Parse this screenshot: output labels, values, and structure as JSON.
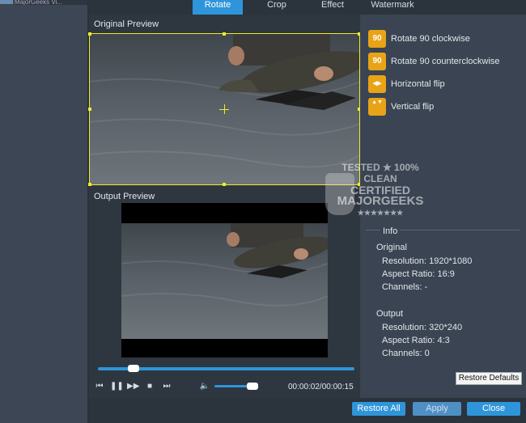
{
  "window": {
    "title": "MajorGeeks Vi..."
  },
  "tabs": [
    "Rotate",
    "Crop",
    "Effect",
    "Watermark"
  ],
  "active_tab": "Rotate",
  "preview": {
    "original_label": "Original Preview",
    "output_label": "Output Preview"
  },
  "rotate_actions": [
    {
      "label": "Rotate 90 clockwise",
      "icon": "rotate-clockwise-icon",
      "glyph": "90"
    },
    {
      "label": "Rotate 90 counterclockwise",
      "icon": "rotate-counterclockwise-icon",
      "glyph": "90"
    },
    {
      "label": "Horizontal flip",
      "icon": "horizontal-flip-icon",
      "glyph": "◀▶"
    },
    {
      "label": "Vertical flip",
      "icon": "vertical-flip-icon",
      "glyph": "▲▼"
    }
  ],
  "watermark_stamp": {
    "lines": [
      "TESTED ★ 100% CLEAN",
      "CERTIFIED",
      "MAJORGEEKS",
      "★★★★★★★"
    ]
  },
  "info": {
    "title": "Info",
    "original": {
      "heading": "Original",
      "resolution": "Resolution: 1920*1080",
      "aspect_ratio": "Aspect Ratio: 16:9",
      "channels": "Channels: -"
    },
    "output": {
      "heading": "Output",
      "resolution": "Resolution: 320*240",
      "aspect_ratio": "Aspect Ratio: 4:3",
      "channels": "Channels: 0"
    }
  },
  "player": {
    "time": "00:00:02/00:00:15",
    "seek_fraction": 0.14,
    "volume_fraction": 0.75
  },
  "buttons": {
    "restore_defaults": "Restore Defaults",
    "restore_all": "Restore All",
    "apply": "Apply",
    "close": "Close"
  },
  "colors": {
    "accent": "#2f95da",
    "crop_frame": "#f0ea2c",
    "icon_bg": "#e8a317"
  }
}
